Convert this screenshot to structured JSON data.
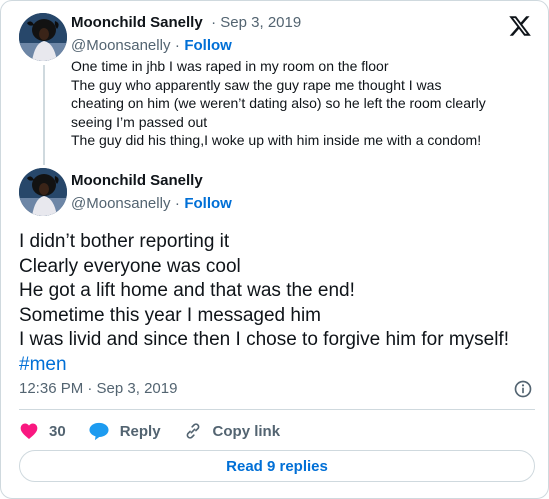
{
  "parent_tweet": {
    "author_name": "Moonchild Sanelly",
    "date": "· Sep 3, 2019",
    "handle": "@Moonsanelly",
    "separator": "·",
    "follow_label": "Follow",
    "lines": [
      "One time in jhb I was raped in my room on the floor",
      "The guy who apparently saw the guy rape me thought I was",
      "cheating on him (we weren’t dating also) so he left the room clearly",
      "seeing I’m passed out",
      "The guy did his thing,I woke up with him inside me with a condom!"
    ]
  },
  "main_tweet": {
    "author_name": "Moonchild Sanelly",
    "handle": "@Moonsanelly",
    "separator": "·",
    "follow_label": "Follow",
    "lines": [
      "I didn’t bother reporting it",
      "Clearly everyone was cool",
      "He got a lift home and that was the end!",
      "Sometime this year I messaged him",
      "I was livid and since then I chose to forgive him for myself!"
    ],
    "hashtag": "#men",
    "timestamp": "12:36 PM · Sep 3, 2019"
  },
  "actions": {
    "like_count": "30",
    "reply_label": "Reply",
    "copy_link_label": "Copy link"
  },
  "read_replies_label": "Read 9 replies",
  "icons": {
    "brand": "x-logo-icon",
    "like": "heart-icon",
    "reply": "speech-bubble-icon",
    "copy": "link-icon",
    "info": "info-icon"
  },
  "colors": {
    "link": "#006fd6",
    "like": "#f91880",
    "reply": "#1d9bf0",
    "muted": "#536471",
    "border": "#cfd9de"
  }
}
